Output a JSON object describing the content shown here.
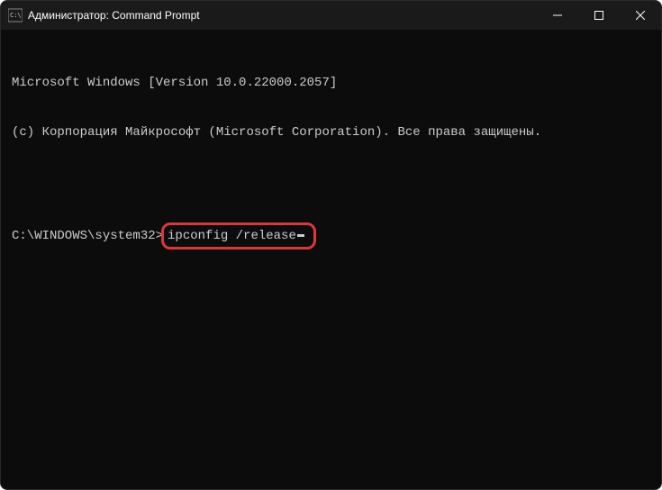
{
  "titlebar": {
    "icon": "cmd-icon",
    "title": "Администратор: Command Prompt"
  },
  "window_controls": {
    "minimize": "minimize",
    "maximize": "maximize",
    "close": "close"
  },
  "terminal": {
    "line1": "Microsoft Windows [Version 10.0.22000.2057]",
    "line2": "(c) Корпорация Майкрософт (Microsoft Corporation). Все права защищены.",
    "prompt": "C:\\WINDOWS\\system32>",
    "command": "ipconfig /release"
  },
  "colors": {
    "highlight_border": "#d63939",
    "terminal_bg": "#0c0c0c",
    "terminal_fg": "#cccccc"
  }
}
